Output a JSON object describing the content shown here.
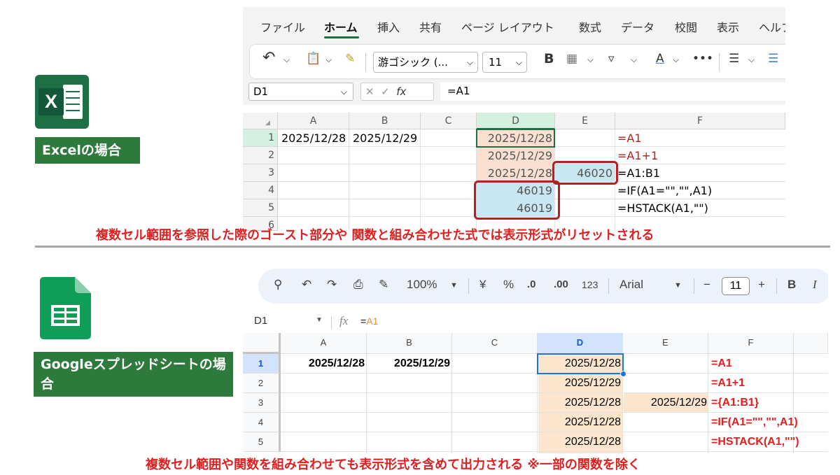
{
  "excel": {
    "label": "Excelの場合",
    "logo_letter": "X",
    "menu": [
      "ファイル",
      "ホーム",
      "挿入",
      "共有",
      "ページ レイアウト",
      "数式",
      "データ",
      "校閲",
      "表示",
      "ヘルプ"
    ],
    "active_menu": "ホーム",
    "ribbon": {
      "undo_icon": "↶",
      "clipboard_icon": "📋",
      "font_name": "游ゴシック (...",
      "font_size": "11",
      "bold": "B",
      "more": "•••"
    },
    "name_box": "D1",
    "formula": "=A1",
    "columns": [
      "A",
      "B",
      "C",
      "D",
      "E",
      "F"
    ],
    "rows": [
      "1",
      "2",
      "3",
      "4",
      "5",
      "6"
    ],
    "cells": {
      "A1": "2025/12/28",
      "B1": "2025/12/29",
      "D1": "2025/12/28",
      "D2": "2025/12/29",
      "D3": "2025/12/28",
      "D4": "46019",
      "D5": "46019",
      "E3": "46020",
      "F1": "=A1",
      "F2": "=A1+1",
      "F3": "=A1:B1",
      "F4": "=IF(A1=\"\",\"\",A1)",
      "F5": "=HSTACK(A1,\"\")"
    },
    "note": "複数セル範囲を参照した際のゴースト部分や 関数と組み合わせた式では表示形式がリセットされる"
  },
  "google": {
    "label": "Googleスプレッドシートの場合",
    "toolbar": {
      "zoom": "100%",
      "currency": "¥",
      "percent": "%",
      "dec_less": ".0",
      "dec_more": ".00",
      "format123": "123",
      "font": "Arial",
      "size": "11",
      "bold": "B",
      "italic": "I",
      "minus": "−",
      "plus": "+"
    },
    "name_box": "D1",
    "fx": "fx",
    "formula_prefix": "=",
    "formula_ref": "A1",
    "columns": [
      "A",
      "B",
      "C",
      "D",
      "E",
      "F"
    ],
    "rows": [
      "1",
      "2",
      "3",
      "4",
      "5"
    ],
    "cells": {
      "A1": "2025/12/28",
      "B1": "2025/12/29",
      "D1": "2025/12/28",
      "D2": "2025/12/29",
      "D3": "2025/12/28",
      "D4": "2025/12/28",
      "D5": "2025/12/28",
      "E3": "2025/12/29",
      "F1": "=A1",
      "F2": "=A1+1",
      "F3": "={A1:B1}",
      "F4": "=IF(A1=\"\",\"\",A1)",
      "F5": "=HSTACK(A1,\"\")"
    },
    "note": "複数セル範囲や関数を組み合わせても表示形式を含めて出力される ※一部の関数を除く"
  },
  "colors": {
    "excel_green": "#1d7044",
    "label_green": "#2e7a3c",
    "red_note": "#e02020",
    "highlight_red": "#b22222",
    "ghost_orange": "#fbe0d2",
    "blue_fill": "#c9e6f3",
    "gs_orange": "#fce5cd",
    "gs_green": "#34a853"
  }
}
